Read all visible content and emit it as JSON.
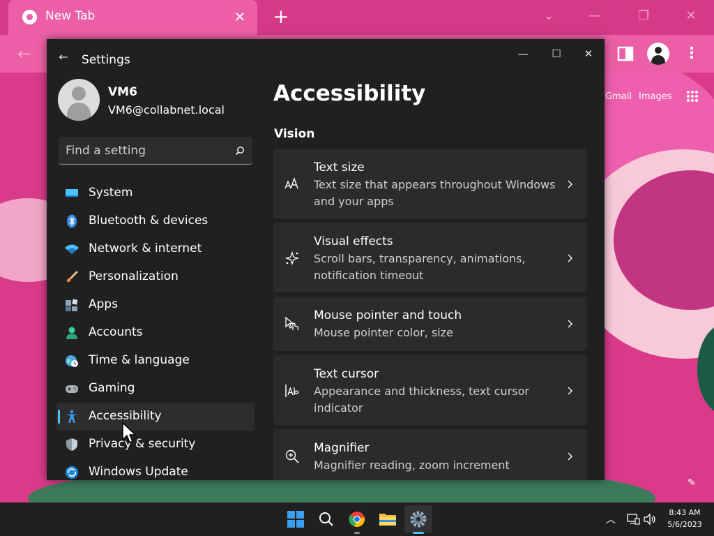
{
  "browser": {
    "tab_title": "New Tab",
    "new_tab_label": "+",
    "gmail_label": "Gmail",
    "images_label": "Images",
    "colors": {
      "frame": "#d63a87",
      "tab": "#ec5fa6"
    }
  },
  "settings": {
    "window_title": "Settings",
    "user": {
      "name": "VM6",
      "email": "VM6@collabnet.local"
    },
    "search": {
      "placeholder": "Find a setting",
      "icon": "search-icon"
    },
    "nav": [
      {
        "label": "System",
        "icon": "system-icon"
      },
      {
        "label": "Bluetooth & devices",
        "icon": "bluetooth-icon"
      },
      {
        "label": "Network & internet",
        "icon": "wifi-icon"
      },
      {
        "label": "Personalization",
        "icon": "brush-icon"
      },
      {
        "label": "Apps",
        "icon": "apps-icon"
      },
      {
        "label": "Accounts",
        "icon": "accounts-icon"
      },
      {
        "label": "Time & language",
        "icon": "globe-clock-icon"
      },
      {
        "label": "Gaming",
        "icon": "gamepad-icon"
      },
      {
        "label": "Accessibility",
        "icon": "accessibility-icon",
        "selected": true
      },
      {
        "label": "Privacy & security",
        "icon": "shield-icon"
      },
      {
        "label": "Windows Update",
        "icon": "update-icon"
      }
    ],
    "page_heading": "Accessibility",
    "section_title": "Vision",
    "cards": [
      {
        "title": "Text size",
        "description": "Text size that appears throughout Windows and your apps",
        "icon": "text-size-icon"
      },
      {
        "title": "Visual effects",
        "description": "Scroll bars, transparency, animations, notification timeout",
        "icon": "visual-effects-icon"
      },
      {
        "title": "Mouse pointer and touch",
        "description": "Mouse pointer color, size",
        "icon": "mouse-pointer-icon"
      },
      {
        "title": "Text cursor",
        "description": "Appearance and thickness, text cursor indicator",
        "icon": "text-cursor-icon"
      },
      {
        "title": "Magnifier",
        "description": "Magnifier reading, zoom increment",
        "icon": "magnifier-icon"
      }
    ],
    "colors": {
      "background": "#202020",
      "card": "#2b2b2b",
      "accent": "#4cc2ff"
    }
  },
  "taskbar": {
    "apps": [
      "start-icon",
      "search-icon",
      "chrome-icon",
      "file-explorer-icon",
      "settings-icon"
    ],
    "clock": {
      "time": "8:43 AM",
      "date": "5/6/2023"
    }
  }
}
